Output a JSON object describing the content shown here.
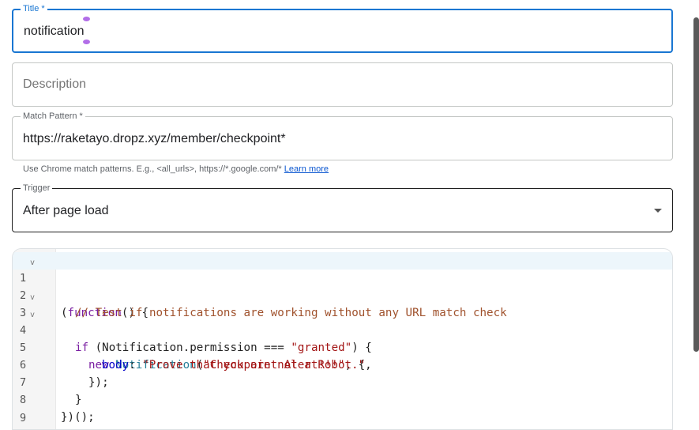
{
  "form": {
    "title": {
      "label": "Title *",
      "value": "notification"
    },
    "description": {
      "placeholder": "Description"
    },
    "match_pattern": {
      "label": "Match Pattern *",
      "value": "https://raketayo.dropz.xyz/member/checkpoint*",
      "helper": "Use Chrome match patterns. E.g., <all_urls>, https://*.google.com/*",
      "helper_link": "Learn more"
    },
    "trigger": {
      "label": "Trigger",
      "value": "After page load"
    }
  },
  "editor": {
    "lines": [
      {
        "num": "1",
        "fold": "v"
      },
      {
        "num": "2",
        "fold": ""
      },
      {
        "num": "3",
        "fold": "v"
      },
      {
        "num": "4",
        "fold": "v"
      },
      {
        "num": "5",
        "fold": ""
      },
      {
        "num": "6",
        "fold": ""
      },
      {
        "num": "7",
        "fold": ""
      },
      {
        "num": "8",
        "fold": ""
      },
      {
        "num": "9",
        "fold": ""
      }
    ],
    "tokens": {
      "l1_open": "(",
      "l1_kw": "function",
      "l1_rest": "() {",
      "l2_comment": "// Test if notifications are working without any URL match check",
      "l3_if": "if",
      "l3_a": " (Notification.permission === ",
      "l3_str": "\"granted\"",
      "l3_b": ") {",
      "l4_new": "new",
      "l4_cls": "Notification",
      "l4_a": "(",
      "l4_str": "\"Checkpoint Alert!!!\"",
      "l4_b": ", {",
      "l5_prop": "body",
      "l5_a": ": ",
      "l5_str": "\"Prove that you are not a Robot.\"",
      "l5_b": ",",
      "l6": "});",
      "l7": "}",
      "l8": "})();"
    }
  },
  "colors": {
    "focus_accent": "#1976d2",
    "link": "#0b57d0",
    "keyword": "#7a1fa2",
    "comment": "#a0522d",
    "string": "#a31515"
  }
}
